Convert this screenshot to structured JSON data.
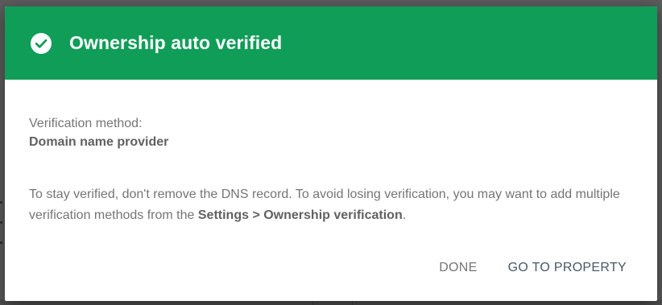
{
  "dialog": {
    "title": "Ownership auto verified",
    "header_color": "#109d58",
    "header_icon": "check-circle-icon",
    "method_label": "Verification method:",
    "method_value": "Domain name provider",
    "info_text_prefix": "To stay verified, don't remove the DNS record. To avoid losing verification, you may want to add multiple verification methods from the ",
    "info_text_link": "Settings > Ownership verification",
    "info_text_suffix": ".",
    "actions": {
      "done_label": "DONE",
      "go_to_property_label": "GO TO PROPERTY"
    }
  }
}
